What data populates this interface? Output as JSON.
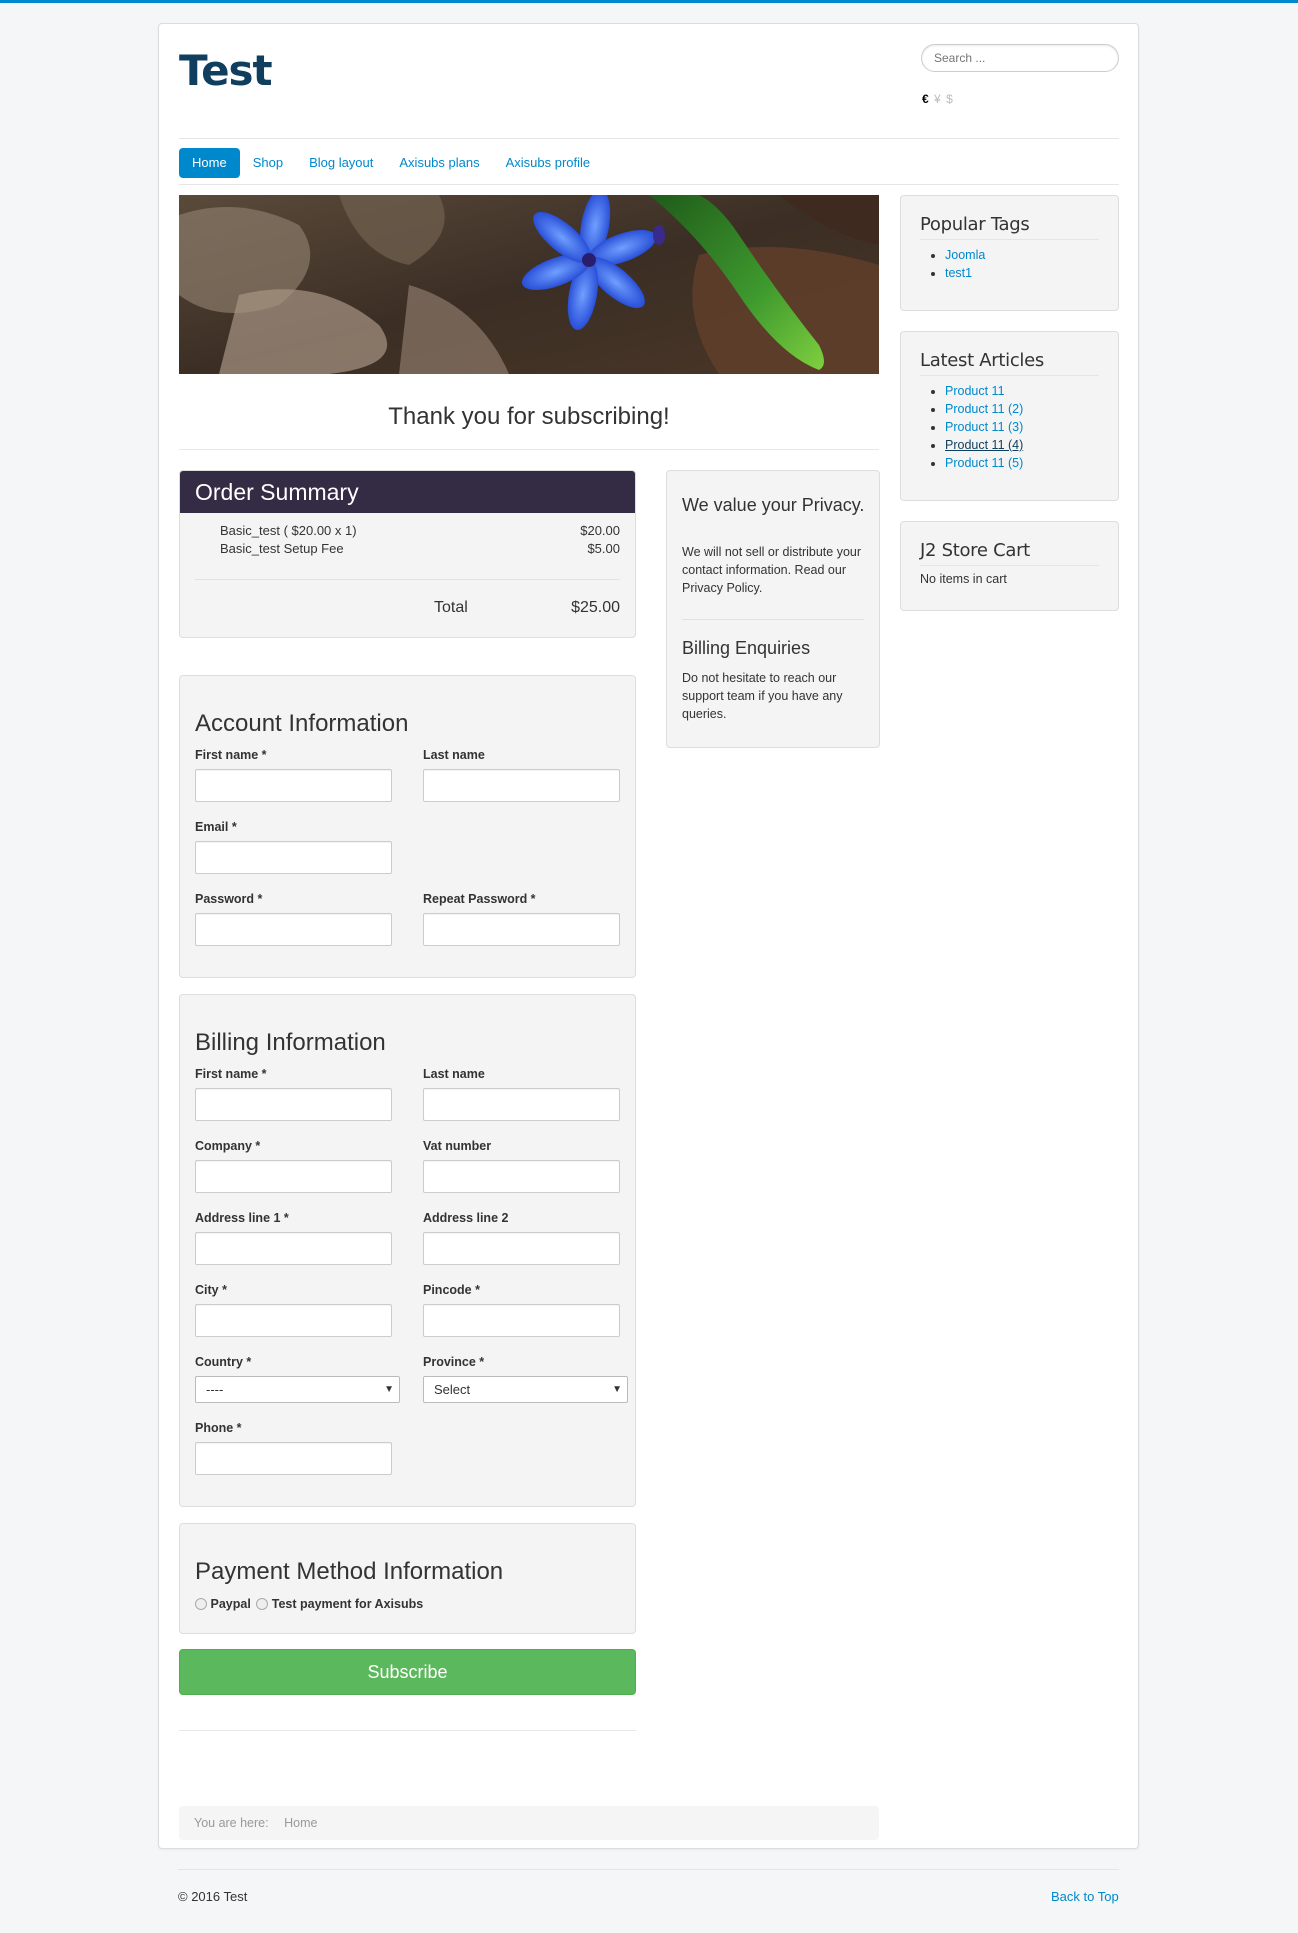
{
  "site": {
    "title": "Test"
  },
  "header": {
    "search_placeholder": "Search ...",
    "currencies": [
      "€",
      "¥",
      "$"
    ]
  },
  "nav": {
    "items": [
      {
        "label": "Home",
        "active": true
      },
      {
        "label": "Shop"
      },
      {
        "label": "Blog layout"
      },
      {
        "label": "Axisubs plans"
      },
      {
        "label": "Axisubs profile"
      }
    ]
  },
  "main": {
    "thanks": "Thank you for subscribing!",
    "order_summary": {
      "title": "Order Summary",
      "lines": [
        {
          "label": "Basic_test ( $20.00 x 1)",
          "amount": "$20.00"
        },
        {
          "label": "Basic_test Setup Fee",
          "amount": "$5.00"
        }
      ],
      "total_label": "Total",
      "total_value": "$25.00"
    },
    "privacy": {
      "title": "We value your Privacy.",
      "text": "We will not sell or distribute your contact information. Read our Privacy Policy.",
      "billing_title": "Billing Enquiries",
      "billing_text": "Do not hesitate to reach our support team if you have any queries."
    },
    "account": {
      "title": "Account Information",
      "first_name": "First name *",
      "last_name": "Last name",
      "email": "Email *",
      "password": "Password *",
      "repeat_password": "Repeat Password *"
    },
    "billing": {
      "title": "Billing Information",
      "first_name": "First name *",
      "last_name": "Last name",
      "company": "Company *",
      "vat": "Vat number",
      "address1": "Address line 1 *",
      "address2": "Address line 2",
      "city": "City *",
      "pincode": "Pincode *",
      "country": "Country *",
      "country_value": "----",
      "province": "Province *",
      "province_value": "Select",
      "phone": "Phone *"
    },
    "payment": {
      "title": "Payment Method Information",
      "options": [
        "Paypal",
        "Test payment for Axisubs"
      ]
    },
    "subscribe_label": "Subscribe",
    "breadcrumb": {
      "prefix": "You are here:",
      "current": "Home"
    }
  },
  "sidebar": {
    "popular_tags": {
      "title": "Popular Tags",
      "items": [
        "Joomla",
        "test1"
      ]
    },
    "latest_articles": {
      "title": "Latest Articles",
      "items": [
        "Product 11",
        "Product 11 (2)",
        "Product 11 (3)",
        "Product 11 (4)",
        "Product 11 (5)"
      ]
    },
    "cart": {
      "title": "J2 Store Cart",
      "text": "No items in cart"
    }
  },
  "footer": {
    "copyright": "© 2016 Test",
    "back_to_top": "Back to Top"
  },
  "colors": {
    "accent": "#0088cc",
    "brand": "#0f3e5e",
    "order_header": "#342b45",
    "subscribe": "#5cb85c"
  }
}
